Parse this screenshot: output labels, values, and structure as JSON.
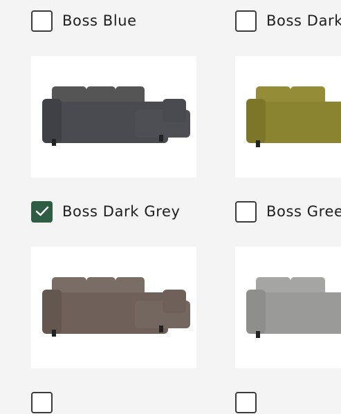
{
  "swatches": [
    {
      "label": "Boss Blue",
      "checked": false,
      "color": "#4a4b50"
    },
    {
      "label": "Boss Dark Grey",
      "checked": false,
      "color": "#8a8330"
    },
    {
      "label": "Boss Dark Grey",
      "checked": true,
      "color": "#6f6159"
    },
    {
      "label": "Boss Green",
      "checked": false,
      "color": "#9a9a98"
    }
  ],
  "colors": {
    "accent": "#2f5d44",
    "sofa_charcoal": "#4a4b50",
    "sofa_olive": "#8a8330",
    "sofa_taupe": "#6f6159",
    "sofa_light_grey": "#9a9a98"
  }
}
